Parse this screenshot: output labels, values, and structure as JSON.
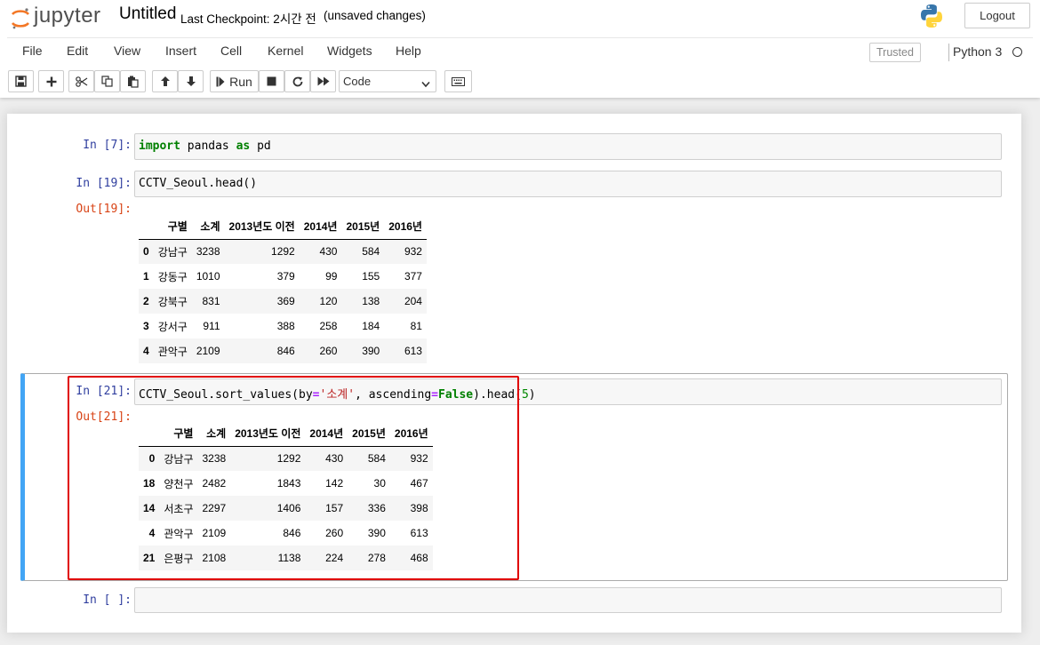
{
  "header": {
    "logo_text": "jupyter",
    "notebook_name": "Untitled",
    "checkpoint": "Last Checkpoint: 2시간 전",
    "unsaved": "(unsaved changes)",
    "logout_label": "Logout"
  },
  "menubar": {
    "items": [
      "File",
      "Edit",
      "View",
      "Insert",
      "Cell",
      "Kernel",
      "Widgets",
      "Help"
    ],
    "trusted_label": "Trusted",
    "kernel_name": "Python 3"
  },
  "toolbar": {
    "run_label": "Run",
    "cell_type": "Code",
    "icons": [
      "save-icon",
      "plus-icon",
      "cut-icon",
      "copy-icon",
      "paste-icon",
      "arrow-up-icon",
      "arrow-down-icon",
      "step-forward-icon",
      "stop-icon",
      "restart-icon",
      "fast-forward-icon",
      "keyboard-icon"
    ]
  },
  "cells": {
    "c1": {
      "prompt": "In [7]:",
      "code": {
        "t1": "import",
        "t2": " pandas ",
        "t3": "as",
        "t4": " pd"
      }
    },
    "c2": {
      "prompt": "In [19]:",
      "code": "CCTV_Seoul.head()",
      "out_prompt": "Out[19]:",
      "table": {
        "columns": [
          "구별",
          "소계",
          "2013년도 이전",
          "2014년",
          "2015년",
          "2016년"
        ],
        "rows": [
          [
            "0",
            "강남구",
            "3238",
            "1292",
            "430",
            "584",
            "932"
          ],
          [
            "1",
            "강동구",
            "1010",
            "379",
            "99",
            "155",
            "377"
          ],
          [
            "2",
            "강북구",
            "831",
            "369",
            "120",
            "138",
            "204"
          ],
          [
            "3",
            "강서구",
            "911",
            "388",
            "258",
            "184",
            "81"
          ],
          [
            "4",
            "관악구",
            "2109",
            "846",
            "260",
            "390",
            "613"
          ]
        ]
      }
    },
    "c3": {
      "prompt": "In [21]:",
      "code": {
        "t1": "CCTV_Seoul.sort_values(by",
        "t2": "=",
        "t3": "'소계'",
        "t4": ", ascending",
        "t5": "=",
        "t6": "False",
        "t7": ").head(",
        "t8": "5",
        "t9": ")"
      },
      "out_prompt": "Out[21]:",
      "table": {
        "columns": [
          "구별",
          "소계",
          "2013년도 이전",
          "2014년",
          "2015년",
          "2016년"
        ],
        "rows": [
          [
            "0",
            "강남구",
            "3238",
            "1292",
            "430",
            "584",
            "932"
          ],
          [
            "18",
            "양천구",
            "2482",
            "1843",
            "142",
            "30",
            "467"
          ],
          [
            "14",
            "서초구",
            "2297",
            "1406",
            "157",
            "336",
            "398"
          ],
          [
            "4",
            "관악구",
            "2109",
            "846",
            "260",
            "390",
            "613"
          ],
          [
            "21",
            "은평구",
            "2108",
            "1138",
            "224",
            "278",
            "468"
          ]
        ]
      }
    },
    "c4": {
      "prompt": "In [ ]:",
      "code": ""
    }
  },
  "colors": {
    "selected_border": "#42a5f5",
    "highlight_box": "#e00000",
    "in_prompt": "#303f9f",
    "out_prompt": "#d84315",
    "keyword": "#008000",
    "string": "#ba2121"
  }
}
